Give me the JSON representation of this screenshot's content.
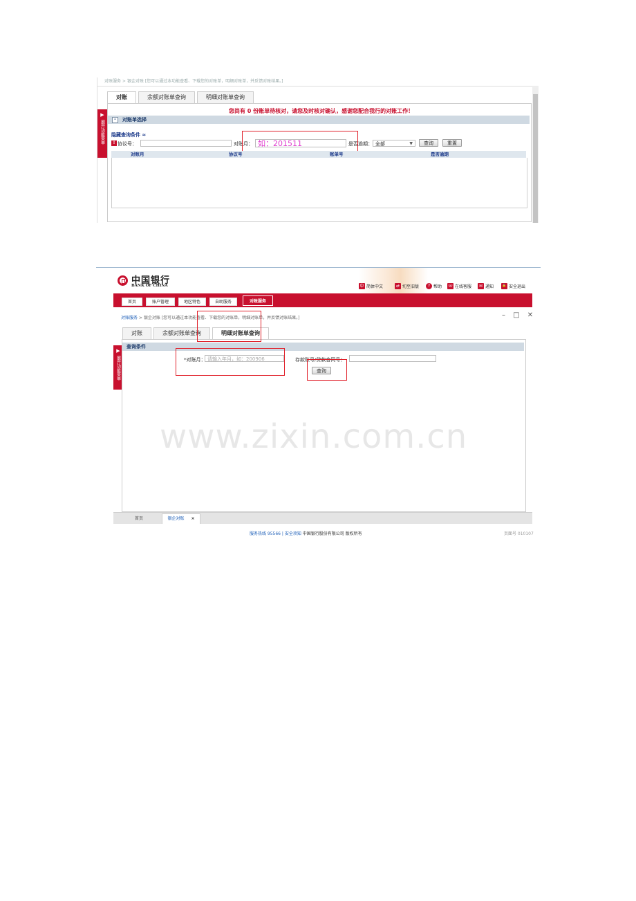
{
  "shot1": {
    "top_text": "对账服务  >  银企对账  [您可以通过本功能查看、下载您的对账单，明细对账单，并反馈对账结果。]",
    "side_tab": "展开功能菜单",
    "tabs": [
      "对账",
      "余额对账单查询",
      "明细对账单查询"
    ],
    "notice": "您尚有 0 份账单待核对，请您及时核对确认，感谢您配合我行的对账工作！",
    "section_title": "对账单选择",
    "collapse_link": "隐藏查询条件 ≈",
    "protocol_label": "协议号：",
    "month_label": "对账月：",
    "month_placeholder": "如：201511",
    "overdue_label": "是否逾期：",
    "overdue_value": "全部",
    "query_btn": "查询",
    "reset_btn": "重置",
    "columns": [
      "对账月",
      "协议号",
      "账单号",
      "是否逾期"
    ]
  },
  "shot2": {
    "logo_cn": "中国银行",
    "logo_en": "BANK OF CHINA",
    "top_links": [
      {
        "icon": "中",
        "label": "简体中文"
      },
      {
        "icon": "⇄",
        "label": "切至旧版"
      },
      {
        "icon": "?",
        "label": "帮助"
      },
      {
        "icon": "☏",
        "label": "在线客服"
      },
      {
        "icon": "✉",
        "label": "通知"
      },
      {
        "icon": "🔒",
        "label": "安全退出"
      }
    ],
    "nav": [
      "首页",
      "账户管理",
      "地区特色",
      "自助服务",
      "对账服务"
    ],
    "crumb_link": "对账服务",
    "crumb_rest": " >  银企对账   [您可以通过本功能查看、下载您的对账单，明细对账单，并反馈对账结果。]",
    "win_controls": "– □ ✕",
    "side_tab": "展开功能菜单",
    "tabs": [
      "对账",
      "余额对账单查询",
      "明细对账单查询"
    ],
    "section_title": "查询条件",
    "month_label": "*对账月：",
    "month_placeholder": "请输入年月，如：200906",
    "account_label": "存款账号/贷款合同号：",
    "query_btn": "查询",
    "watermark": "www.zixin.com.cn",
    "bottom_tabs": [
      "首页",
      "银企对账"
    ],
    "bottom_close": "×",
    "footer_link": "服务热线  95566 | 安全须知",
    "footer_text": "中国银行股份有限公司  版权所有",
    "page_no": "页面号 010107"
  }
}
